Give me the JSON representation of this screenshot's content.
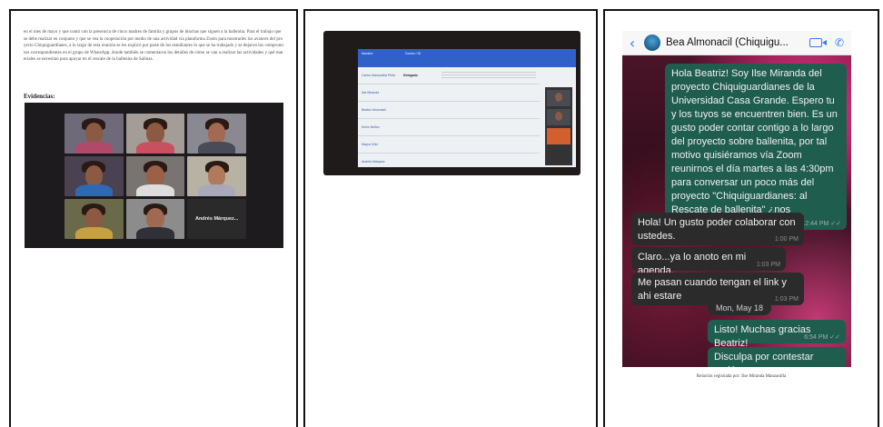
{
  "panel1": {
    "body_text": "en el mes de mayo y que contó con la presencia de cinco madres de familia y grupos de hinchas que siguen a la ballenita. Para el trabajo que se debe realizar en conjunto y que se vea la cooperación por medio de una actividad vía plataforma Zoom para mostrarles los avances del proyecto Chiquiguardianes, a lo largo de esta reunión se les explicó por parte de los estudiantes lo que se ha trabajado y se dejaron los compromisos correspondientes en el grupo de WhatsApp, donde también se comentaron los detalles de cómo se van a realizar las actividades y qué materiales se necesitan para apoyar en el rescate de la ballenita de Salinas.",
    "heading": "Evidencias:",
    "zoom_tiles": [
      {
        "name": ""
      },
      {
        "name": ""
      },
      {
        "name": ""
      },
      {
        "name": ""
      },
      {
        "name": ""
      },
      {
        "name": ""
      },
      {
        "name": ""
      },
      {
        "name": ""
      },
      {
        "name": "Andrés Márquez..."
      }
    ]
  },
  "panel2": {
    "table_headers": [
      "Nombre",
      "Correo / ID",
      ""
    ],
    "rows": [
      {
        "name": "Carlos Manzanilla Peña",
        "value": "Delegado"
      },
      {
        "name": "Ilse Miranda",
        "value": ""
      },
      {
        "name": "Beatriz Almonacil",
        "value": ""
      },
      {
        "name": "Kevin Núñez",
        "value": ""
      },
      {
        "name": "Mayra Ortiz",
        "value": ""
      },
      {
        "name": "Andrés Márquez",
        "value": ""
      }
    ]
  },
  "panel3": {
    "contact_name": "Bea Almonacil (Chiquigu...",
    "messages": [
      {
        "dir": "out",
        "text": "Hola Beatriz! Soy Ilse Miranda del proyecto Chiquiguardianes de la Universidad Casa Grande. Espero tu y los tuyos se encuentren bien. Es un gusto poder contar contigo a lo largo del proyecto sobre ballenita, por tal motivo quisiéramos vía Zoom reunirnos el día martes a las 4:30pm para conversar un poco más del proyecto \"Chiquiguardianes: al Rescate de ballenita\" ¿nos acompañas?",
        "time": "12:44 PM ✓✓"
      },
      {
        "dir": "in",
        "text": "Hola! Un gusto poder colaborar con ustedes.",
        "time": "1:00 PM"
      },
      {
        "dir": "in",
        "text": "Claro...ya lo anoto en mi agenda.",
        "time": "1:03 PM"
      },
      {
        "dir": "in",
        "text": "Me pasan cuando tengan el link y ahi estare",
        "time": "1:03 PM"
      },
      {
        "dir": "out",
        "text": "Listo! Muchas gracias Beatriz!",
        "time": "6:54 PM ✓✓"
      },
      {
        "dir": "out",
        "text": "Disculpa por contestar recién",
        "time": ""
      }
    ],
    "date_label": "Mon, May 18",
    "caption": "Relación registrada por: Ilse Miranda Manzanilla"
  }
}
